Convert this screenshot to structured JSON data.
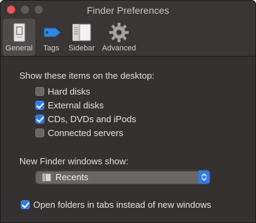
{
  "window": {
    "title": "Finder Preferences"
  },
  "toolbar": {
    "tabs": [
      {
        "label": "General",
        "icon": "general-icon",
        "selected": true
      },
      {
        "label": "Tags",
        "icon": "tag-icon",
        "selected": false
      },
      {
        "label": "Sidebar",
        "icon": "sidebar-icon",
        "selected": false
      },
      {
        "label": "Advanced",
        "icon": "gear-icon",
        "selected": false
      }
    ]
  },
  "desktop_section": {
    "heading": "Show these items on the desktop:",
    "items": [
      {
        "label": "Hard disks",
        "checked": false
      },
      {
        "label": "External disks",
        "checked": true
      },
      {
        "label": "CDs, DVDs and iPods",
        "checked": true
      },
      {
        "label": "Connected servers",
        "checked": false
      }
    ]
  },
  "new_window_section": {
    "heading": "New Finder windows show:",
    "selected_value": "Recents"
  },
  "tabs_option": {
    "label": "Open folders in tabs instead of new windows",
    "checked": true
  },
  "colors": {
    "accent": "#2d7bf4",
    "close": "#ec5b57",
    "window_bg": "#353131"
  }
}
